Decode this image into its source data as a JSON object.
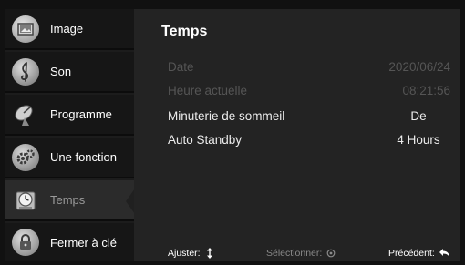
{
  "sidebar": {
    "items": [
      {
        "label": "Image",
        "icon": "image-icon"
      },
      {
        "label": "Son",
        "icon": "music-note-icon"
      },
      {
        "label": "Programme",
        "icon": "satellite-dish-icon"
      },
      {
        "label": "Une fonction",
        "icon": "gears-icon"
      },
      {
        "label": "Temps",
        "icon": "clock-icon",
        "active": true
      },
      {
        "label": "Fermer à clé",
        "icon": "padlock-icon"
      }
    ]
  },
  "main": {
    "title": "Temps",
    "rows": [
      {
        "label": "Date",
        "value": "2020/06/24",
        "enabled": false
      },
      {
        "label": "Heure actuelle",
        "value": "08:21:56",
        "enabled": false
      },
      {
        "label": "Minuterie de sommeil",
        "value": "De",
        "enabled": true
      },
      {
        "label": "Auto Standby",
        "value": "4 Hours",
        "enabled": true
      }
    ]
  },
  "footer": {
    "adjust": "Ajuster:",
    "select": "Sélectionner:",
    "back": "Précédent:"
  },
  "colors": {
    "background": "#202020",
    "sidebar": "#161616",
    "active": "#2b2b2b",
    "disabled_text": "#555555"
  }
}
